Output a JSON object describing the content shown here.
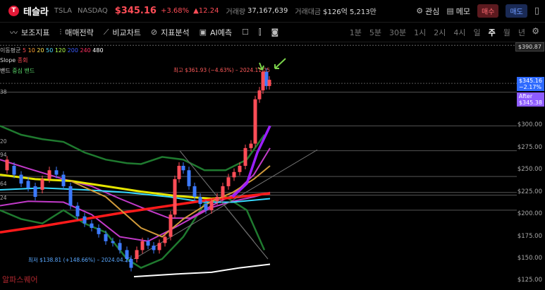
{
  "header": {
    "logo": "T",
    "name": "테슬라",
    "ticker": "TSLA",
    "exchange": "NASDAQ",
    "price": "$345.16",
    "change_pct": "+3.68%",
    "change_abs": "▲12.24",
    "volume_label": "거래량",
    "volume": "37,167,639",
    "amount_label": "거래대금",
    "amount": "$126억 5,213만",
    "watch": "관심",
    "memo": "메모",
    "buy": "매수",
    "sell": "매도"
  },
  "toolbar": {
    "indicators": "보조지표",
    "strategy": "매매전략",
    "compare": "비교차트",
    "analysis": "지표분석",
    "ai": "AI예측",
    "periods": [
      "1분",
      "5분",
      "30분",
      "1시",
      "2시",
      "4시",
      "일",
      "주",
      "월",
      "년"
    ],
    "active_period": "주"
  },
  "legend": {
    "ma_label": "이동평균",
    "ma_periods": [
      "5",
      "10",
      "20",
      "50",
      "120",
      "200",
      "240",
      "480"
    ],
    "ma_colors": [
      "#ff4d57",
      "#ff9d2e",
      "#ffe14d",
      "#4dd8ff",
      "#b0ff4d",
      "#3a5bff",
      "#ff3060",
      "#ffffff"
    ],
    "slope_label": "Slope",
    "slope_sub": "종회",
    "band_label": "밴드",
    "band_sub": "중심 밴드"
  },
  "annotations": {
    "high": "최고 $361.93 (−4.63%) – 2024.11.25",
    "low": "최저 $138.81 (+148.66%) – 2024.04.22",
    "watermark": "알파스퀘어",
    "left_1": "38",
    "left_2": "20",
    "left_3": "94",
    "left_4": "64",
    "left_5": "24"
  },
  "axis": {
    "top_tag": "$390.87",
    "ticks": [
      "$300.00",
      "$275.00",
      "$250.00",
      "$225.00",
      "$200.00",
      "$175.00",
      "$150.00",
      "$125.00"
    ],
    "current_price": "$345.16",
    "current_pct": "−2.17%",
    "after_label": "After",
    "after_price": "$345.38"
  },
  "chart_data": {
    "type": "candlestick",
    "interval": "weekly",
    "ylim": [
      115,
      395
    ],
    "high": 361.93,
    "low": 138.81,
    "last": 345.16,
    "after_hours": 345.38
  }
}
